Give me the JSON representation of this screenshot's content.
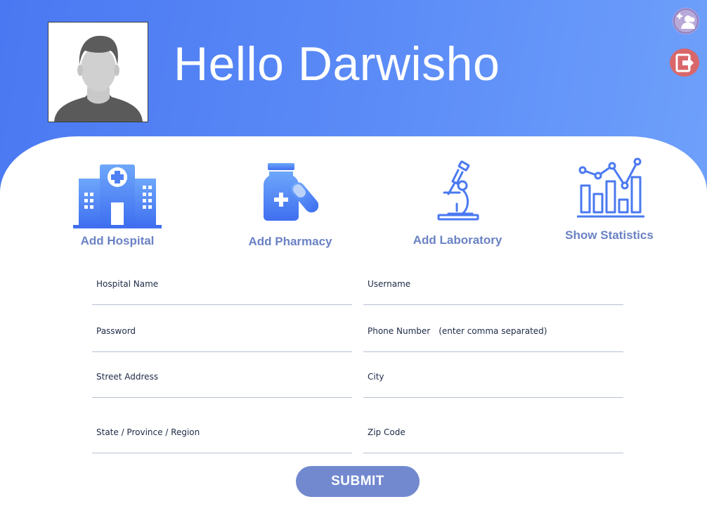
{
  "header": {
    "greeting": "Hello Darwisho",
    "avatar_icon": "user-silhouette-icon",
    "add_user_icon": "add-user-icon",
    "logout_icon": "logout-icon"
  },
  "nav": [
    {
      "label": "Add Hospital",
      "icon": "hospital-icon"
    },
    {
      "label": "Add Pharmacy",
      "icon": "pharmacy-icon"
    },
    {
      "label": "Add Laboratory",
      "icon": "microscope-icon"
    },
    {
      "label": "Show Statistics",
      "icon": "statistics-icon"
    }
  ],
  "form": {
    "hospital_name": {
      "label": "Hospital Name",
      "value": ""
    },
    "username": {
      "label": "Username",
      "value": ""
    },
    "password": {
      "label": "Password",
      "value": ""
    },
    "phone": {
      "label": "Phone Number",
      "hint": "(enter comma separated)",
      "value": ""
    },
    "street": {
      "label": "Street Address",
      "value": ""
    },
    "city": {
      "label": "City",
      "value": ""
    },
    "state": {
      "label": "State / Province / Region",
      "value": ""
    },
    "zip": {
      "label": "Zip Code",
      "value": ""
    },
    "submit_label": "SUBMIT"
  },
  "colors": {
    "header_start": "#4a78f2",
    "header_end": "#6ea0fb",
    "accent": "#6a82c4",
    "submit_bg": "#7289cf",
    "logout_bg": "#d9676a",
    "add_user_bg": "#b8a9d9"
  }
}
